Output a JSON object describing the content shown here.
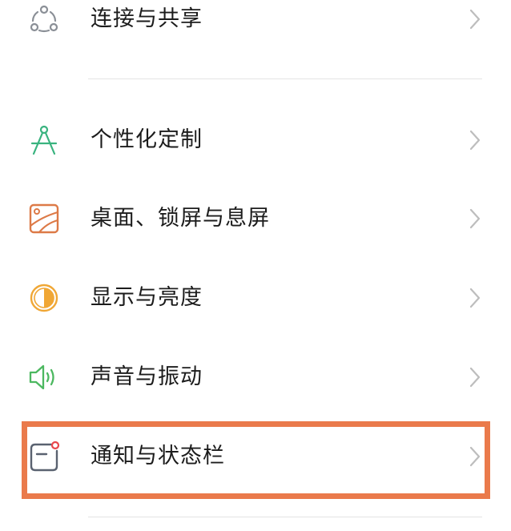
{
  "settings": {
    "items": [
      {
        "label": "连接与共享",
        "icon": "connection-share-icon"
      },
      {
        "label": "个性化定制",
        "icon": "compass-icon"
      },
      {
        "label": "桌面、锁屏与息屏",
        "icon": "wallpaper-icon"
      },
      {
        "label": "显示与亮度",
        "icon": "brightness-icon"
      },
      {
        "label": "声音与振动",
        "icon": "speaker-icon"
      },
      {
        "label": "通知与状态栏",
        "icon": "notification-icon"
      }
    ]
  },
  "colors": {
    "highlight_border": "#ea7a4b",
    "connection_icon": "#8a8f96",
    "compass_icon": "#39b37f",
    "wallpaper_icon": "#dd7a47",
    "brightness_icon": "#f0a735",
    "speaker_icon": "#4cb860",
    "notification_icon": "#5a6270",
    "notification_dot": "#e9474c"
  }
}
